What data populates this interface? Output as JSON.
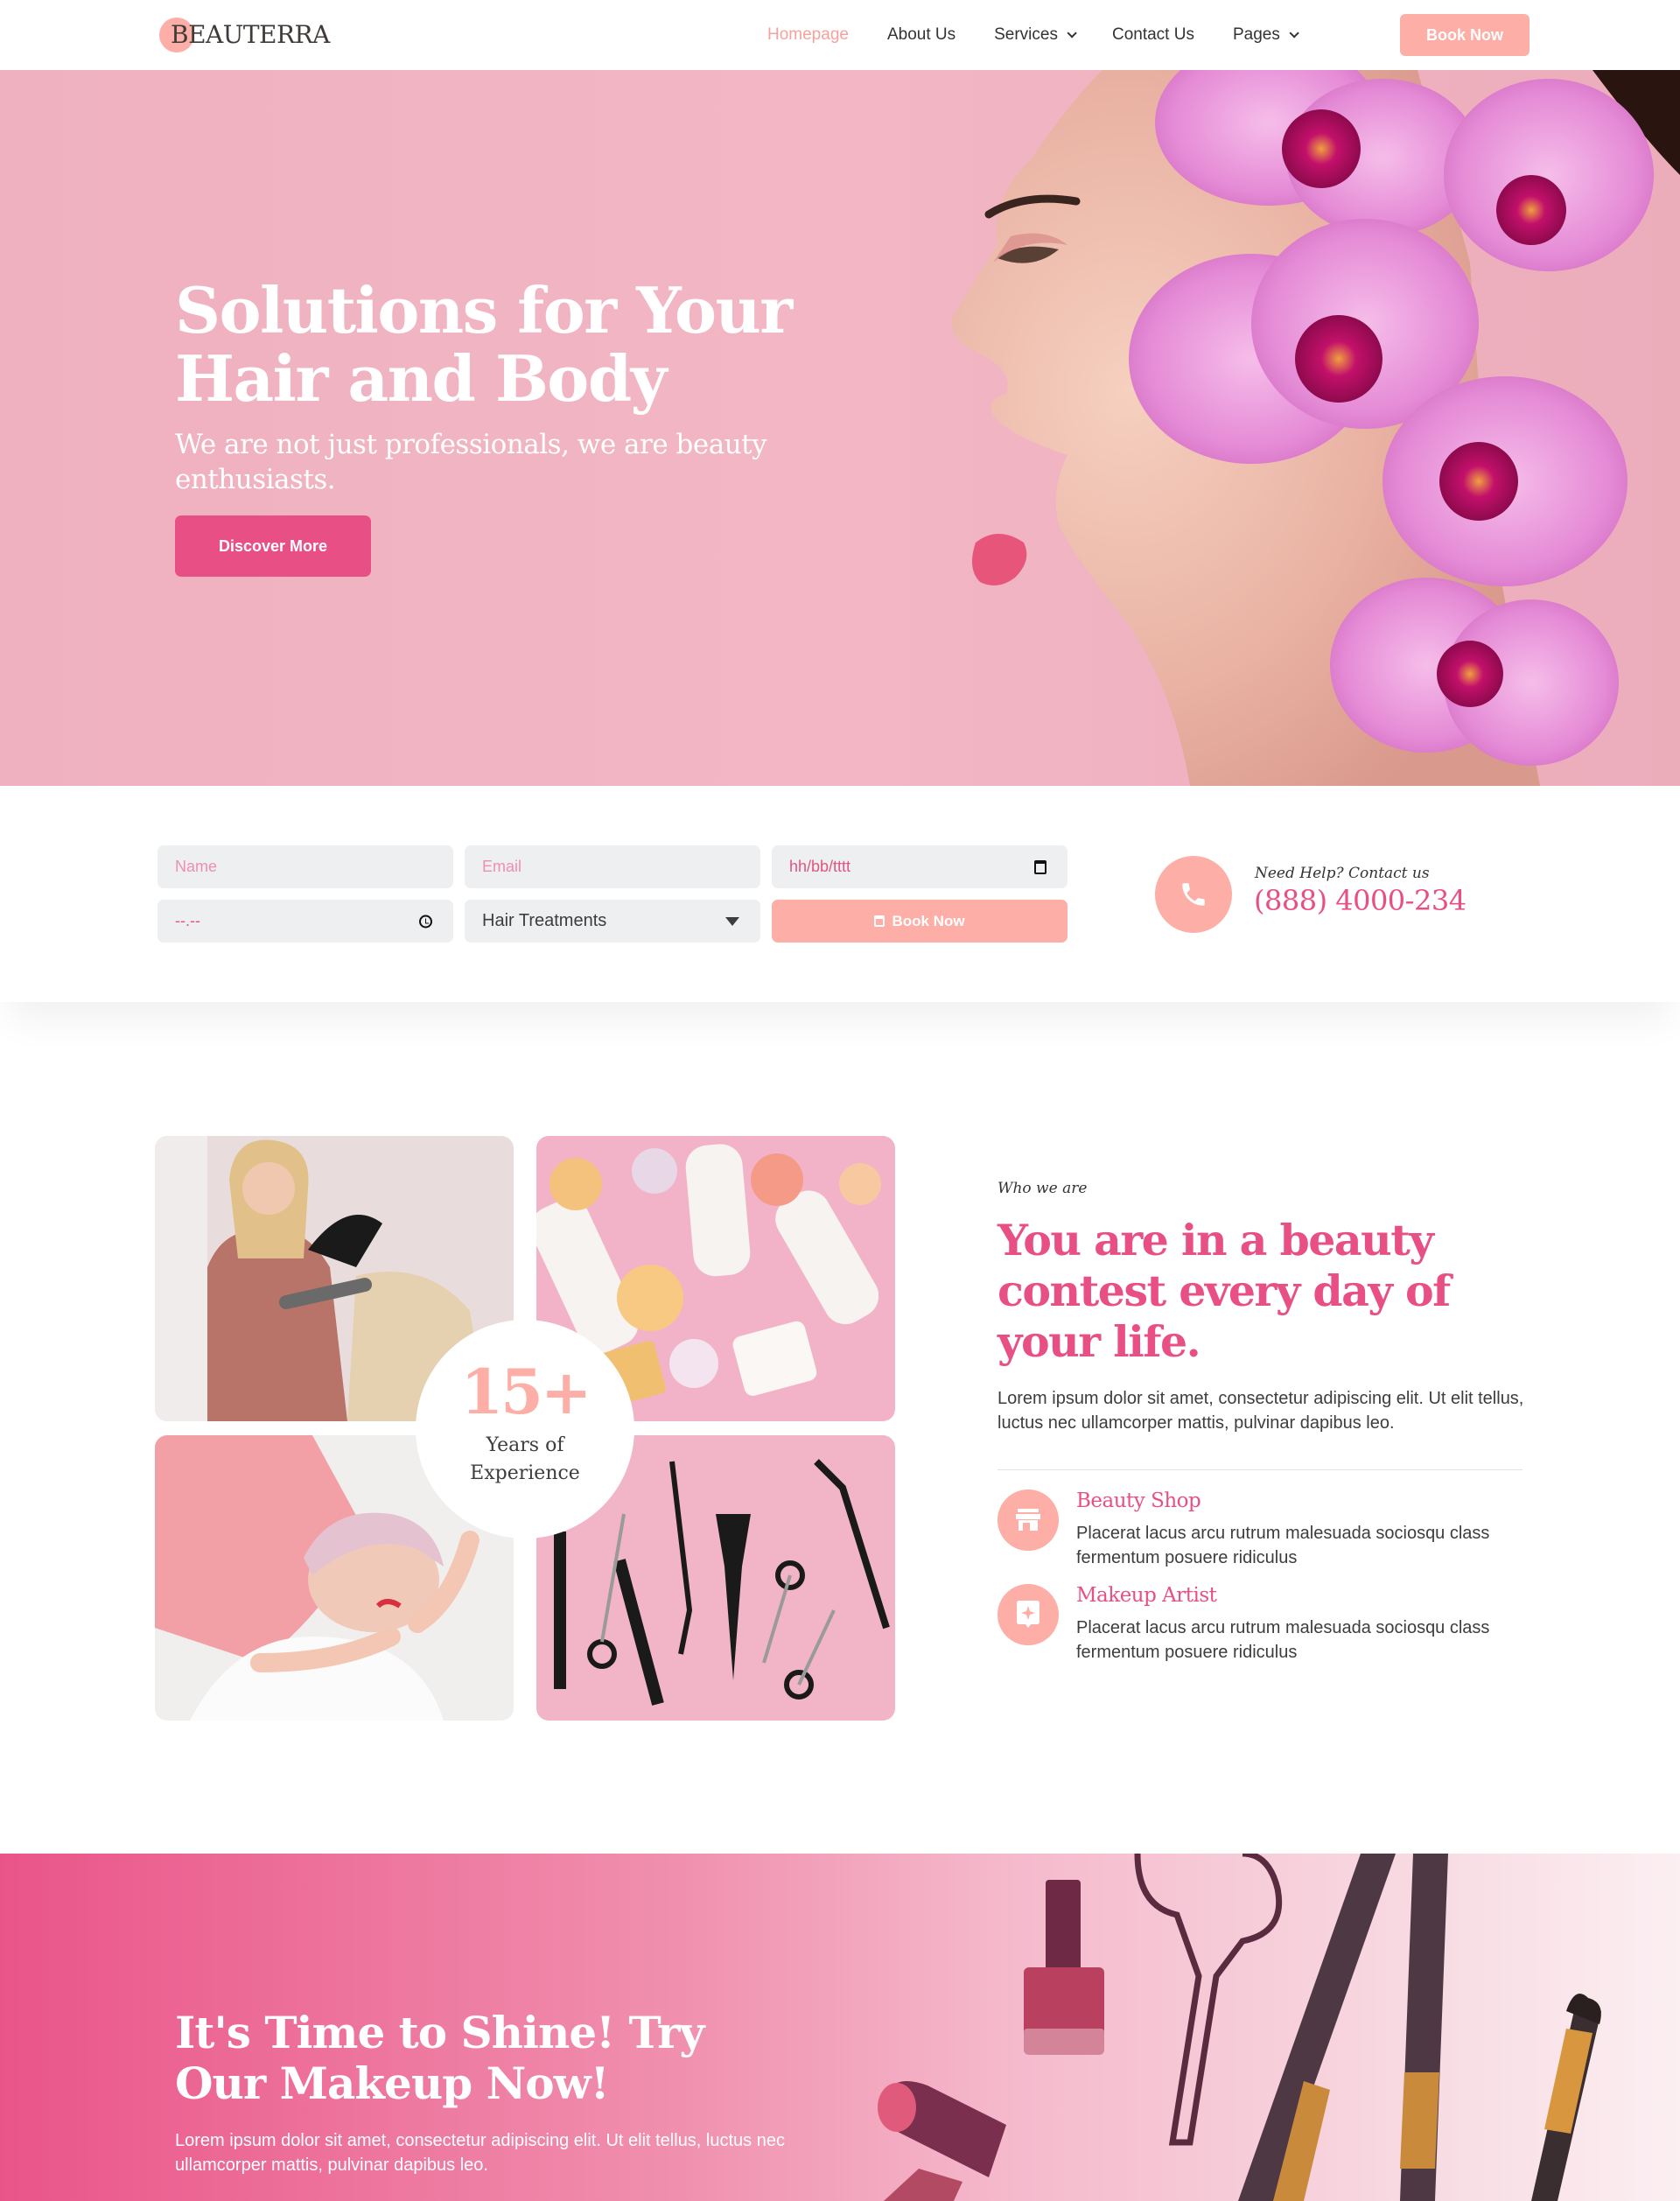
{
  "header": {
    "logo": "BEAUTERRA",
    "nav": [
      {
        "label": "Homepage",
        "active": true,
        "dropdown": false
      },
      {
        "label": "About Us",
        "active": false,
        "dropdown": false
      },
      {
        "label": "Services",
        "active": false,
        "dropdown": true
      },
      {
        "label": "Contact Us",
        "active": false,
        "dropdown": false
      },
      {
        "label": "Pages",
        "active": false,
        "dropdown": true
      }
    ],
    "book_button": "Book Now"
  },
  "hero": {
    "title": "Solutions for Your Hair and Body",
    "subtitle": "We are not just professionals, we are beauty enthusiasts.",
    "button": "Discover More",
    "image_icon": "woman-with-orchids-image"
  },
  "booking": {
    "name_placeholder": "Name",
    "email_placeholder": "Email",
    "date_placeholder": "hh/bb/tttt",
    "time_placeholder": "--.--",
    "service_selected": "Hair Treatments",
    "submit_label": "Book Now",
    "contact_label": "Need Help? Contact us",
    "contact_phone": "(888) 4000-234"
  },
  "about": {
    "experience_number": "15+",
    "experience_label": "Years of Experience",
    "images": [
      "hair-stylist-image",
      "spa-towels-soap-image",
      "facial-massage-image",
      "hair-tools-image"
    ],
    "eyebrow": "Who we are",
    "title": "You are in a beauty contest every day of your life.",
    "text": "Lorem ipsum dolor sit amet, consectetur adipiscing elit. Ut elit tellus, luctus nec ullamcorper mattis, pulvinar dapibus leo.",
    "features": [
      {
        "title": "Beauty Shop",
        "text": "Placerat lacus arcu rutrum malesuada sociosqu class fermentum posuere ridiculus",
        "icon": "store-icon"
      },
      {
        "title": "Makeup Artist",
        "text": "Placerat lacus arcu rutrum malesuada sociosqu class fermentum posuere ridiculus",
        "icon": "sparkle-badge-icon"
      }
    ]
  },
  "cta": {
    "title": "It's Time to Shine! Try Our Makeup Now!",
    "text": "Lorem ipsum dolor sit amet, consectetur adipiscing elit. Ut elit tellus, luctus nec ullamcorper mattis, pulvinar dapibus leo."
  },
  "colors": {
    "accent": "#e85085",
    "accent_light": "#fcaea7",
    "hero_bg": "#f0b3c1",
    "field_bg": "#eeeff1"
  }
}
